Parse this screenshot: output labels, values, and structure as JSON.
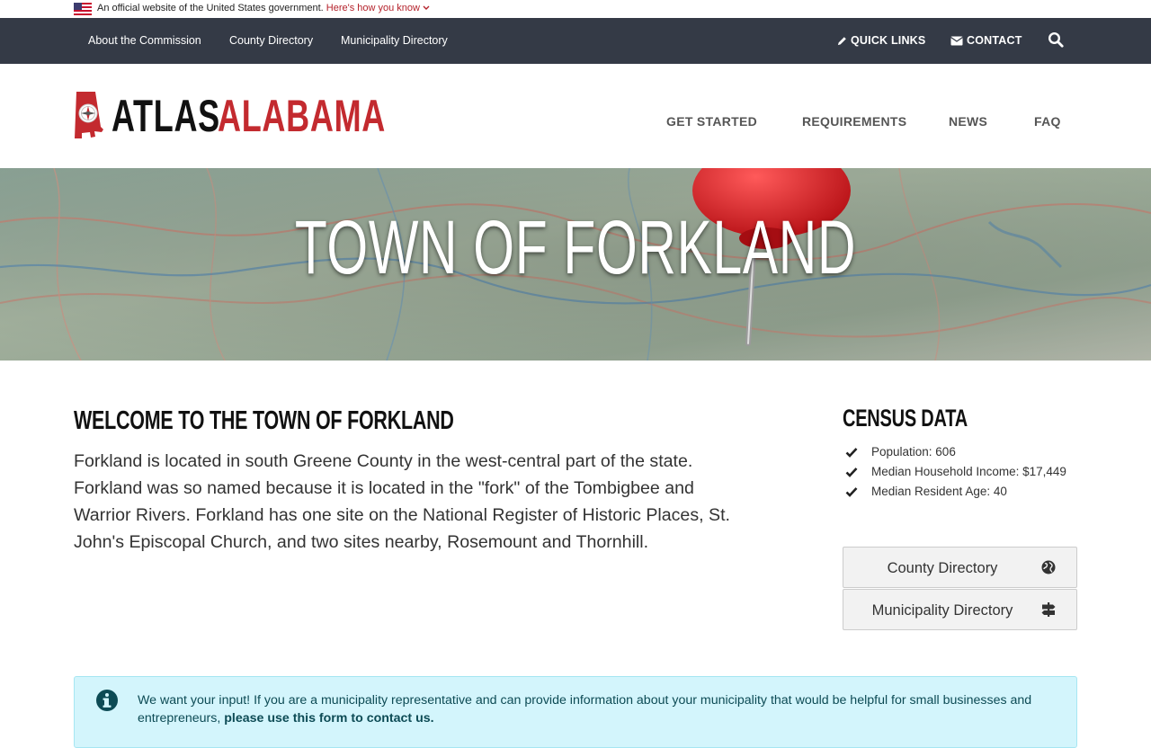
{
  "gov_banner": {
    "text": "An official website of the United States government.",
    "link": "Here's how you know"
  },
  "topbar": {
    "about": "About the Commission",
    "county_directory": "County Directory",
    "municipality_directory": "Municipality Directory",
    "quick_links": "QUICK LINKS",
    "contact": "CONTACT"
  },
  "logo": {
    "part1": "ATLAS",
    "part2": "ALABAMA"
  },
  "mainnav": {
    "get_started": "GET STARTED",
    "requirements": "REQUIREMENTS",
    "news": "NEWS",
    "faq": "FAQ"
  },
  "hero": {
    "title": "TOWN OF FORKLAND"
  },
  "welcome": {
    "heading": "WELCOME TO THE TOWN OF FORKLAND",
    "body": "Forkland is located in south Greene County in the west-central part of the state. Forkland was so named because it is located in the \"fork\" of the Tombigbee and Warrior Rivers. Forkland has one site on the National Register of Historic Places, St. John's Episcopal Church, and two sites nearby, Rosemount and Thornhill."
  },
  "census": {
    "heading": "CENSUS DATA",
    "items": [
      "Population: 606",
      "Median Household Income: $17,449",
      "Median Resident Age: 40"
    ]
  },
  "sidebar_buttons": {
    "county": "County Directory",
    "municipality": "Municipality Directory"
  },
  "alert": {
    "text": "We want your input! If you are a municipality representative and can provide information about your municipality that would be helpful for small businesses and entrepreneurs,",
    "link": "please use this form to contact us."
  },
  "colors": {
    "topbar_bg": "#343a46",
    "brand_red": "#c32a2f",
    "alert_bg": "#d3f5fc",
    "alert_text": "#0d4b55"
  }
}
